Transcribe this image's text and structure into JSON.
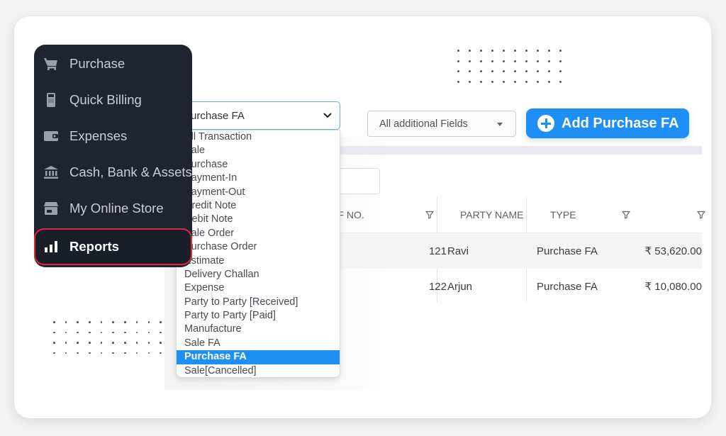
{
  "sidebar": {
    "items": [
      {
        "label": "Purchase",
        "icon": "cart-icon"
      },
      {
        "label": "Quick Billing",
        "icon": "pos-terminal-icon"
      },
      {
        "label": "Expenses",
        "icon": "wallet-icon"
      },
      {
        "label": "Cash, Bank & Assets",
        "icon": "bank-icon"
      },
      {
        "label": "My Online Store",
        "icon": "store-icon"
      },
      {
        "label": "Reports",
        "icon": "bar-chart-icon",
        "active": true
      }
    ]
  },
  "transaction_filter": {
    "selected": "Purchase FA",
    "options": [
      "All Transaction",
      "Sale",
      "Purchase",
      "Payment-In",
      "Payment-Out",
      "Credit Note",
      "Debit Note",
      "Sale Order",
      "Purchase Order",
      "Estimate",
      "Delivery Challan",
      "Expense",
      "Party to Party [Received]",
      "Party to Party [Paid]",
      "Manufacture",
      "Sale FA",
      "Purchase FA",
      "Sale[Cancelled]"
    ],
    "highlighted_index": 16
  },
  "additional_fields": {
    "label": "All additional Fields"
  },
  "add_button": {
    "label": "Add Purchase FA"
  },
  "table": {
    "headers": [
      "REF NO.",
      "PARTY NAME",
      "TYPE",
      ""
    ],
    "rows": [
      {
        "ref_no": "121",
        "party_name": "Ravi",
        "type": "Purchase FA",
        "amount": "₹ 53,620.00"
      },
      {
        "ref_no": "122",
        "party_name": "Arjun",
        "type": "Purchase FA",
        "amount": "₹ 10,080.00"
      }
    ]
  },
  "colors": {
    "accent": "#1e8ff5",
    "sidebar_bg": "#1f2430",
    "active_border": "#d82c3a"
  }
}
